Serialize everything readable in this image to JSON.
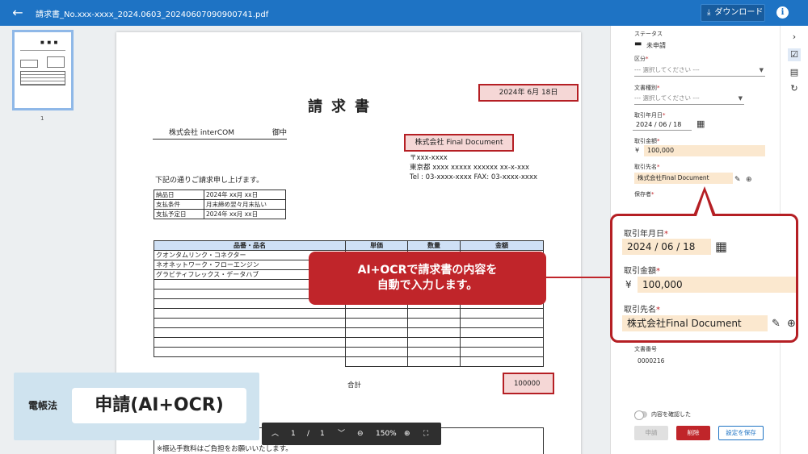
{
  "topbar": {
    "filename": "請求書_No.xxx-xxxx_2024.0603_20240607090900741.pdf",
    "download_label": "ダウンロード"
  },
  "thumbnails": [
    {
      "page": "1"
    }
  ],
  "document": {
    "date": "2024年 6月 18日",
    "title": "請求書",
    "to_company": "株式会社 interCOM",
    "to_suffix": "御中",
    "from_company": "株式会社 Final Document",
    "address_lines": [
      "〒xxx-xxxx",
      "東京都 xxxx xxxxx xxxxxx xx-x-xxx",
      "Tel : 03-xxxx-xxxx FAX: 03-xxxx-xxxx"
    ],
    "greeting": "下記の通りご請求申し上げます。",
    "terms": [
      {
        "label": "納品日",
        "value": "2024年 xx月 xx日"
      },
      {
        "label": "支払条件",
        "value": "月末締め翌々月末払い"
      },
      {
        "label": "支払予定日",
        "value": "2024年 xx月 xx日"
      }
    ],
    "item_headers": [
      "品番・品名",
      "単価",
      "数量",
      "金額"
    ],
    "items": [
      "クオンタムリンク・コネクター",
      "ネオネットワーク・フローエンジン",
      "グラビティフレックス・データハブ"
    ],
    "total_label": "合計",
    "total_value": "100000",
    "note": "※振込手数料はご負担をお願いいたします。"
  },
  "pager": {
    "current": "1",
    "separator": "/",
    "total": "1",
    "zoom": "150%"
  },
  "callout": {
    "line1": "AI+OCRで請求書の内容を",
    "line2": "自動で入力します。"
  },
  "panel": {
    "status_label": "ステータス",
    "status_value": "未申請",
    "category_label": "区分",
    "category_placeholder": "--- 選択してください ---",
    "doctype_label": "文書種別",
    "doctype_placeholder": "--- 選択してください ---",
    "date_label": "取引年月日",
    "date_value": "2024 / 06 / 18",
    "amount_label": "取引金額",
    "currency": "¥",
    "amount_value": "100,000",
    "partner_label": "取引先名",
    "partner_value": "株式会社Final Document",
    "keeper_label": "保存者",
    "docnum_label": "文書番号",
    "docnum_value": "0000216",
    "confirm_label": "内容を確認した",
    "apply_label": "申請",
    "delete_label": "削除",
    "save_label": "設定を保存"
  },
  "badge": {
    "small": "電帳法",
    "large": "申請(AI+OCR)"
  },
  "colors": {
    "topbar": "#1e73c4",
    "highlight_border": "#b51f24",
    "highlight_fill": "#f5d7d6",
    "field_fill": "#fbe8cf",
    "callout": "#c0252a"
  }
}
